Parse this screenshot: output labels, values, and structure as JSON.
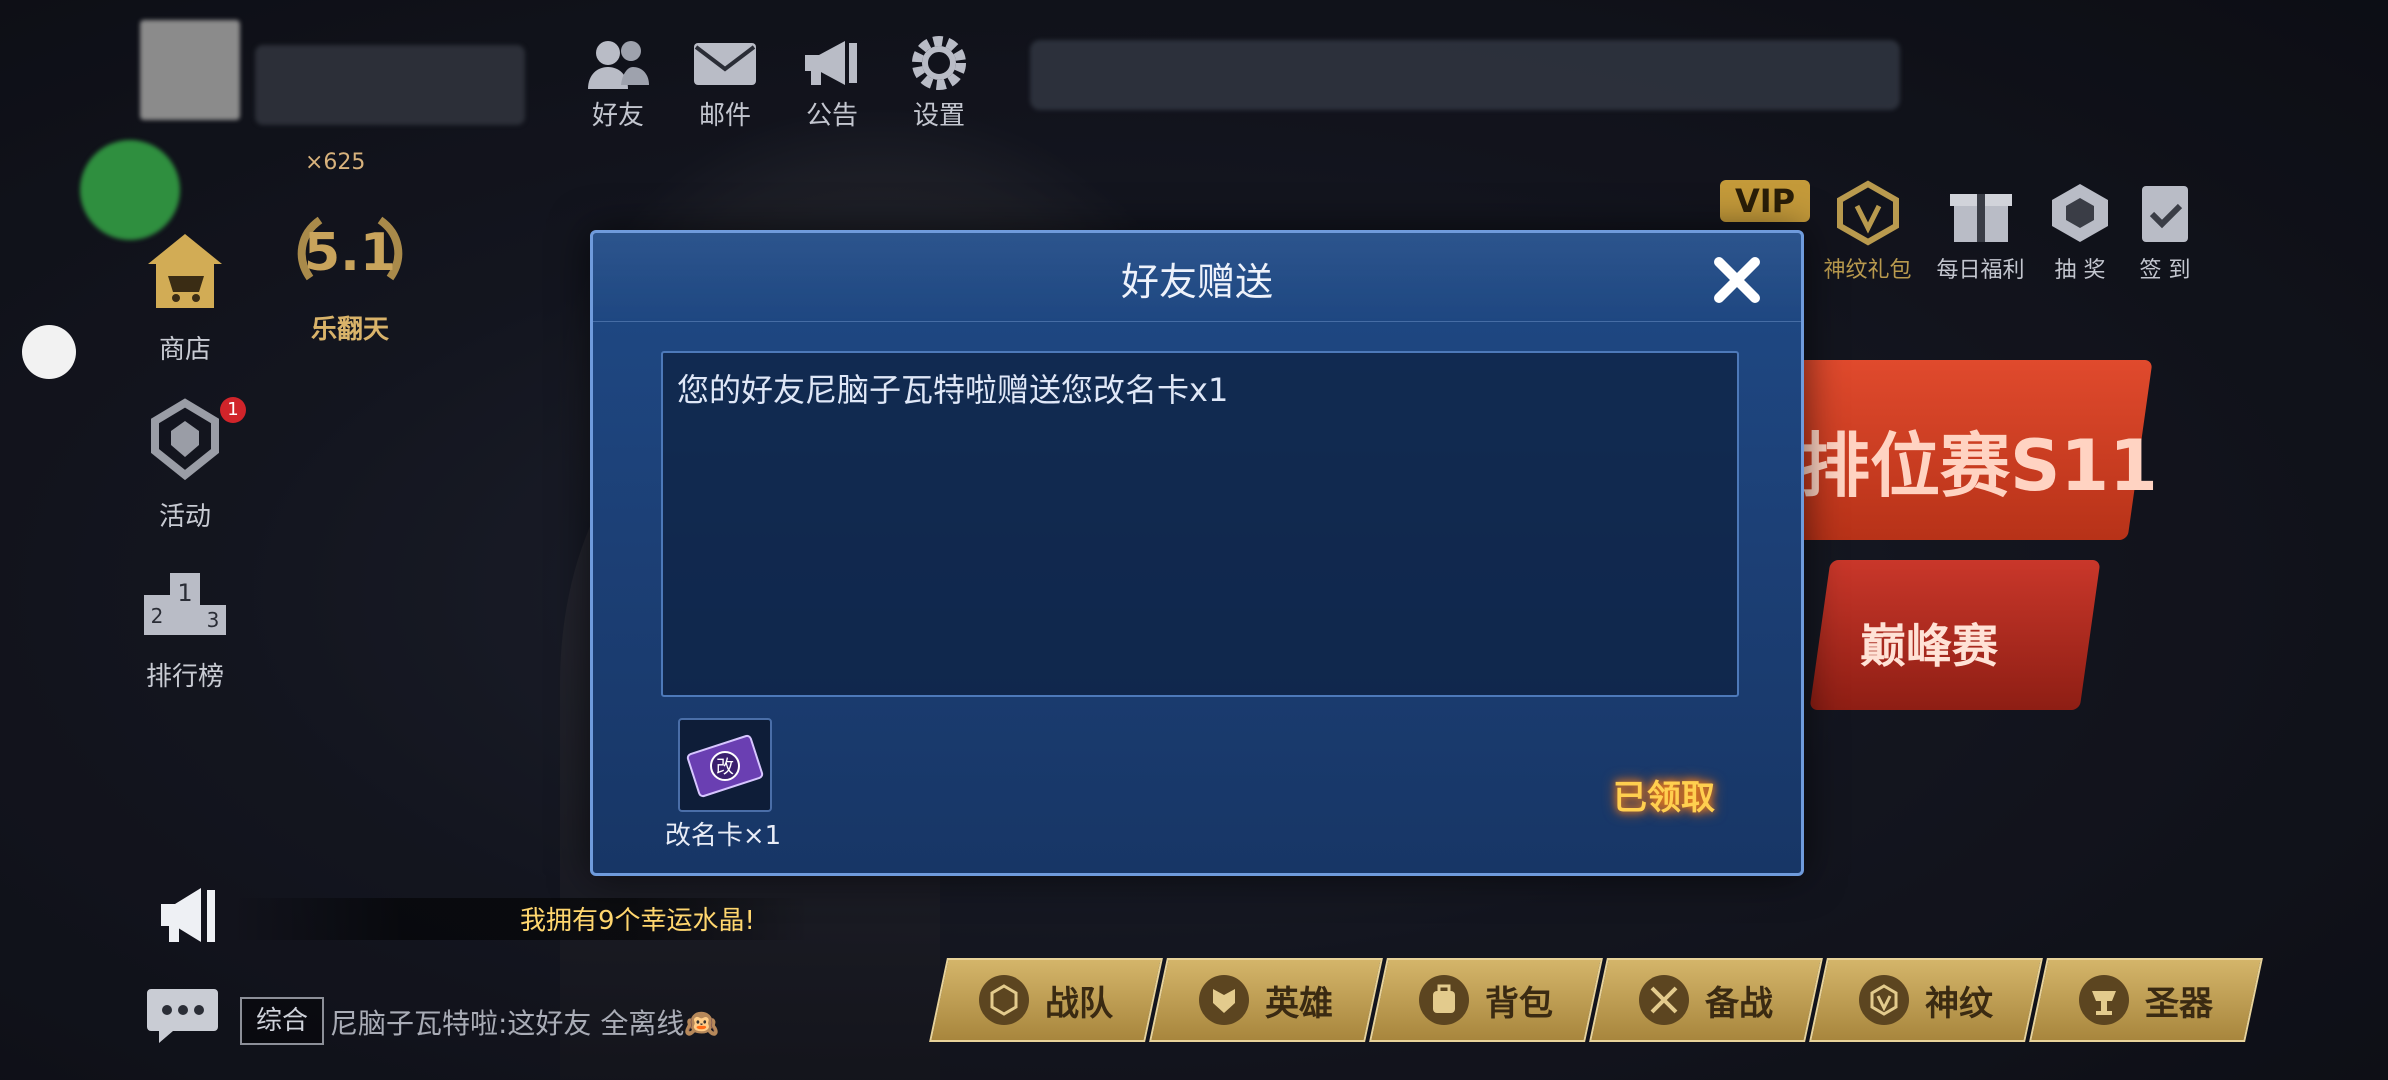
{
  "top_menu": [
    {
      "label": "好友",
      "icon": "friends-icon"
    },
    {
      "label": "邮件",
      "icon": "mail-icon"
    },
    {
      "label": "公告",
      "icon": "announcement-icon"
    },
    {
      "label": "设置",
      "icon": "settings-icon"
    }
  ],
  "player": {
    "currency_text": "×625"
  },
  "left_menu": [
    {
      "label": "商店",
      "icon": "shop-icon"
    },
    {
      "label": "乐翻天",
      "icon": "event-emblem-icon"
    },
    {
      "label": "活动",
      "icon": "activity-icon",
      "badge": "1"
    },
    {
      "label": "排行榜",
      "icon": "leaderboard-icon"
    }
  ],
  "right_menu": [
    {
      "label": "VIP",
      "icon": "vip-icon"
    },
    {
      "label": "神纹礼包",
      "icon": "rune-gift-icon"
    },
    {
      "label": "每日福利",
      "icon": "daily-gift-icon"
    },
    {
      "label": "抽 奖",
      "icon": "lottery-icon"
    },
    {
      "label": "签 到",
      "icon": "checkin-icon"
    }
  ],
  "banners": {
    "rank": "排位赛S11",
    "peak": "巅峰赛"
  },
  "dialog": {
    "title": "好友赠送",
    "message": "您的好友尼脑子瓦特啦赠送您改名卡x1",
    "item_label": "改名卡×1",
    "item_glyph": "改",
    "status": "已领取"
  },
  "chat": {
    "marquee": "我拥有9个幸运水晶!",
    "tab": "综合",
    "message": "尼脑子瓦特啦:这好友 全离线🙉"
  },
  "bottom_nav": [
    {
      "label": "战队",
      "icon": "team-icon"
    },
    {
      "label": "英雄",
      "icon": "hero-icon"
    },
    {
      "label": "背包",
      "icon": "backpack-icon"
    },
    {
      "label": "备战",
      "icon": "prepare-icon"
    },
    {
      "label": "神纹",
      "icon": "rune-icon"
    },
    {
      "label": "圣器",
      "icon": "artifact-icon"
    }
  ],
  "colors": {
    "dialog_bg": "#1c3f75",
    "claimed_text": "#ffcf4f",
    "nav_gold": "#c9a95d"
  }
}
